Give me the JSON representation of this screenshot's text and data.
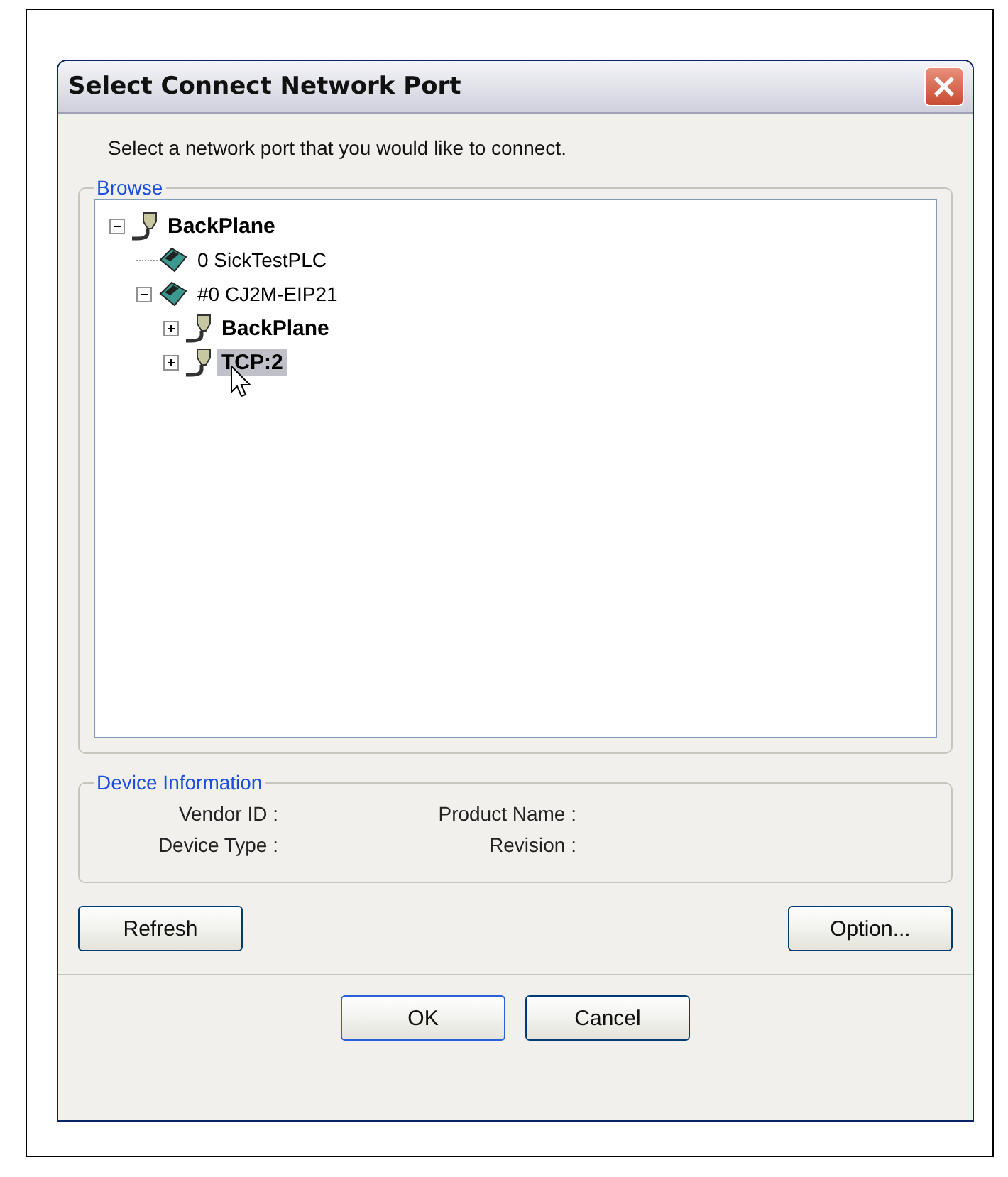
{
  "window": {
    "title": "Select Connect Network Port"
  },
  "instruction": "Select a network port that you would like to connect.",
  "browse": {
    "label": "Browse",
    "tree": [
      {
        "kind": "port",
        "label": "BackPlane",
        "expanded": true,
        "selected": false,
        "children": [
          {
            "kind": "device",
            "label": "0 SickTestPLC",
            "selected": false
          },
          {
            "kind": "device",
            "label": "#0 CJ2M-EIP21",
            "expanded": true,
            "selected": false,
            "children": [
              {
                "kind": "port",
                "label": "BackPlane",
                "expanded": false,
                "selected": false
              },
              {
                "kind": "port",
                "label": "TCP:2",
                "expanded": false,
                "selected": true
              }
            ]
          }
        ]
      }
    ]
  },
  "device_information": {
    "label": "Device Information",
    "fields": [
      {
        "label": "Vendor ID :"
      },
      {
        "label": "Product Name :"
      },
      {
        "label": "Device Type :"
      },
      {
        "label": "Revision :"
      }
    ]
  },
  "buttons": {
    "left": "Refresh",
    "right": "Option...",
    "ok": "OK",
    "cancel": "Cancel"
  }
}
